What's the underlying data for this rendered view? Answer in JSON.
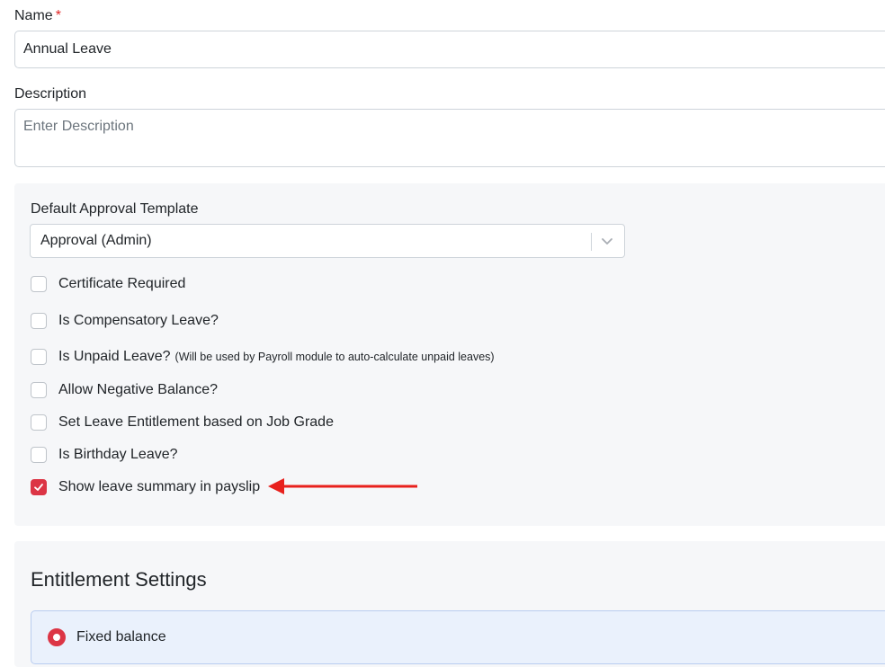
{
  "form": {
    "name_label": "Name",
    "name_required_mark": "*",
    "name_value": "Annual Leave",
    "description_label": "Description",
    "description_placeholder": "Enter Description"
  },
  "approval": {
    "label": "Default Approval Template",
    "selected": "Approval (Admin)"
  },
  "options": [
    {
      "label": "Certificate Required",
      "checked": false
    },
    {
      "label": "Is Compensatory Leave?",
      "checked": false
    },
    {
      "label": "Is Unpaid Leave?",
      "note": "(Will be used by Payroll module to auto-calculate unpaid leaves)",
      "checked": false
    },
    {
      "label": "Allow Negative Balance?",
      "checked": false
    },
    {
      "label": "Set Leave Entitlement based on Job Grade",
      "checked": false
    },
    {
      "label": "Is Birthday Leave?",
      "checked": false
    },
    {
      "label": "Show leave summary in payslip",
      "checked": true
    }
  ],
  "colors": {
    "accent": "#dc3545",
    "annotation_arrow": "#e8211d"
  },
  "entitlement": {
    "title": "Entitlement Settings",
    "option_label": "Fixed balance"
  }
}
